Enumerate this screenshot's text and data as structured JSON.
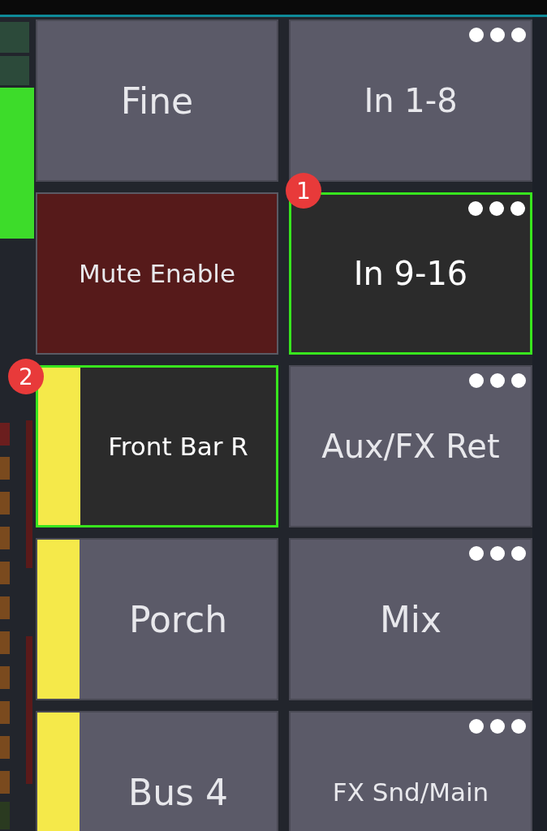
{
  "cells": [
    {
      "label": "Fine",
      "kind": "plain",
      "selected": false
    },
    {
      "label": "In 1-8",
      "kind": "group",
      "selected": false
    },
    {
      "label": "Mute Enable",
      "kind": "mute",
      "selected": false
    },
    {
      "label": "In 9-16",
      "kind": "group",
      "selected": true,
      "badge": "1"
    },
    {
      "label": "Front Bar R",
      "kind": "channel",
      "selected": true,
      "color": "#f5e94a",
      "badge": "2"
    },
    {
      "label": "Aux/FX Ret",
      "kind": "group",
      "selected": false
    },
    {
      "label": "Porch",
      "kind": "channel",
      "selected": false,
      "color": "#f5e94a"
    },
    {
      "label": "Mix",
      "kind": "group",
      "selected": false
    },
    {
      "label": "Bus 4",
      "kind": "channel",
      "selected": false,
      "color": "#f5e94a"
    },
    {
      "label": "FX Snd/Main",
      "kind": "group",
      "selected": false
    }
  ]
}
